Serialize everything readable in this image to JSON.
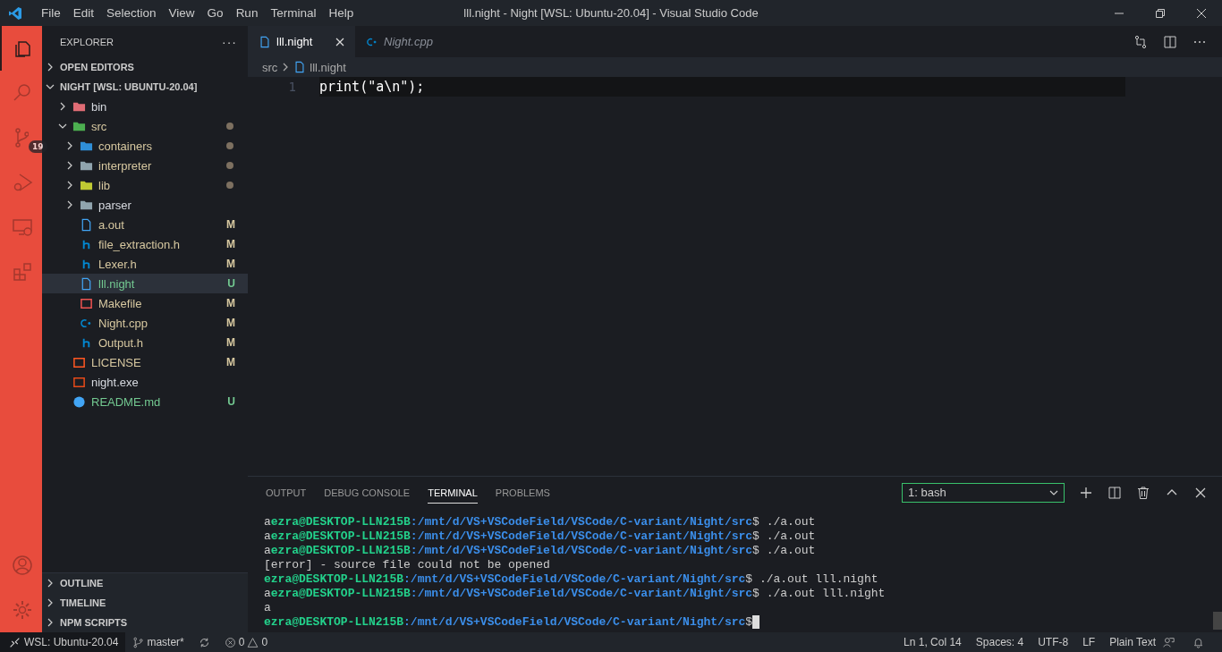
{
  "window": {
    "title": "lll.night - Night [WSL: Ubuntu-20.04] - Visual Studio Code"
  },
  "menu": [
    "File",
    "Edit",
    "Selection",
    "View",
    "Go",
    "Run",
    "Terminal",
    "Help"
  ],
  "activity_bar": {
    "items": [
      {
        "kind": "explorer",
        "selected": true
      },
      {
        "kind": "search",
        "selected": false
      },
      {
        "kind": "source-control",
        "selected": false,
        "badge": "19"
      },
      {
        "kind": "run",
        "selected": false
      },
      {
        "kind": "remote",
        "selected": false
      },
      {
        "kind": "extensions",
        "selected": false
      }
    ],
    "bottom": [
      {
        "kind": "account"
      },
      {
        "kind": "settings"
      }
    ]
  },
  "sidebar": {
    "title": "EXPLORER",
    "more": "···",
    "sections_top": [
      {
        "label": "OPEN EDITORS",
        "expanded": false
      },
      {
        "label": "NIGHT [WSL: UBUNTU-20.04]",
        "expanded": true
      }
    ],
    "tree": [
      {
        "name": "bin",
        "kind": "bin-folder",
        "expanded": false,
        "modified": false,
        "untracked": false,
        "selected": false
      },
      {
        "name": "src",
        "kind": "src-folder",
        "expanded": true,
        "modified": true,
        "untracked": false,
        "selected": false,
        "children": [
          {
            "name": "containers",
            "kind": "blue-folder",
            "expanded": false,
            "modified": true,
            "untracked": false,
            "selected": false
          },
          {
            "name": "interpreter",
            "kind": "folder",
            "expanded": false,
            "modified": true,
            "untracked": false,
            "selected": false
          },
          {
            "name": "lib",
            "kind": "lib-folder",
            "expanded": false,
            "modified": true,
            "untracked": false,
            "selected": false
          },
          {
            "name": "parser",
            "kind": "folder",
            "expanded": false,
            "modified": false,
            "untracked": false,
            "selected": false
          },
          {
            "name": "a.out",
            "kind": "file",
            "modified": true,
            "untracked": false,
            "badge": "M",
            "selected": false
          },
          {
            "name": "file_extraction.h",
            "kind": "header",
            "modified": true,
            "untracked": false,
            "badge": "M",
            "selected": false
          },
          {
            "name": "Lexer.h",
            "kind": "header",
            "modified": true,
            "untracked": false,
            "badge": "M",
            "selected": false
          },
          {
            "name": "lll.night",
            "kind": "file",
            "modified": false,
            "untracked": true,
            "badge": "U",
            "selected": true
          },
          {
            "name": "Makefile",
            "kind": "makefile",
            "modified": true,
            "untracked": false,
            "badge": "M",
            "selected": false
          },
          {
            "name": "Night.cpp",
            "kind": "cpp",
            "modified": true,
            "untracked": false,
            "badge": "M",
            "selected": false
          },
          {
            "name": "Output.h",
            "kind": "header",
            "modified": true,
            "untracked": false,
            "badge": "M",
            "selected": false
          }
        ]
      },
      {
        "name": "LICENSE",
        "kind": "license",
        "modified": true,
        "untracked": false,
        "badge": "M",
        "selected": false
      },
      {
        "name": "night.exe",
        "kind": "exe",
        "modified": false,
        "untracked": false,
        "selected": false
      },
      {
        "name": "README.md",
        "kind": "info",
        "modified": false,
        "untracked": true,
        "badge": "U",
        "selected": false
      }
    ],
    "sections_bottom": [
      {
        "label": "OUTLINE",
        "expanded": false
      },
      {
        "label": "TIMELINE",
        "expanded": false
      },
      {
        "label": "NPM SCRIPTS",
        "expanded": false
      }
    ]
  },
  "tabs": [
    {
      "label": "lll.night",
      "kind": "file",
      "selected": true,
      "preview": false
    },
    {
      "label": "Night.cpp",
      "kind": "cpp",
      "selected": false,
      "preview": true
    }
  ],
  "breadcrumb": [
    "src",
    "lll.night"
  ],
  "editor": {
    "lines": [
      {
        "number": "1",
        "text": "print(\"a\\n\");"
      }
    ]
  },
  "panel": {
    "tabs": [
      {
        "label": "OUTPUT",
        "selected": false
      },
      {
        "label": "DEBUG CONSOLE",
        "selected": false
      },
      {
        "label": "TERMINAL",
        "selected": true
      },
      {
        "label": "PROBLEMS",
        "selected": false
      }
    ],
    "terminal_select": "1: bash",
    "terminal": [
      {
        "kind": "prompt",
        "prefix": "a",
        "user": "ezra@DESKTOP-LLN215B",
        "path": ":/mnt/d/VS+VSCodeField/VSCode/C-variant/Night/src",
        "command": "$ ./a.out"
      },
      {
        "kind": "prompt",
        "prefix": "a",
        "user": "ezra@DESKTOP-LLN215B",
        "path": ":/mnt/d/VS+VSCodeField/VSCode/C-variant/Night/src",
        "command": "$ ./a.out"
      },
      {
        "kind": "prompt",
        "prefix": "a",
        "user": "ezra@DESKTOP-LLN215B",
        "path": ":/mnt/d/VS+VSCodeField/VSCode/C-variant/Night/src",
        "command": "$ ./a.out"
      },
      {
        "kind": "output",
        "text": "[error] - source file could not be opened"
      },
      {
        "kind": "prompt",
        "user": "ezra@DESKTOP-LLN215B",
        "path": ":/mnt/d/VS+VSCodeField/VSCode/C-variant/Night/src",
        "command": "$ ./a.out lll.night"
      },
      {
        "kind": "prompt",
        "prefix": "a",
        "user": "ezra@DESKTOP-LLN215B",
        "path": ":/mnt/d/VS+VSCodeField/VSCode/C-variant/Night/src",
        "command": "$ ./a.out lll.night"
      },
      {
        "kind": "output",
        "text": "a"
      },
      {
        "kind": "prompt",
        "user": "ezra@DESKTOP-LLN215B",
        "path": ":/mnt/d/VS+VSCodeField/VSCode/C-variant/Night/src",
        "command": "$",
        "cursor": true
      }
    ]
  },
  "status_bar": {
    "remote": "WSL: Ubuntu-20.04",
    "branch": "master*",
    "errors": "0",
    "warnings": "0",
    "right": [
      "Ln 1, Col 14",
      "Spaces: 4",
      "UTF-8",
      "LF",
      "Plain Text"
    ]
  }
}
